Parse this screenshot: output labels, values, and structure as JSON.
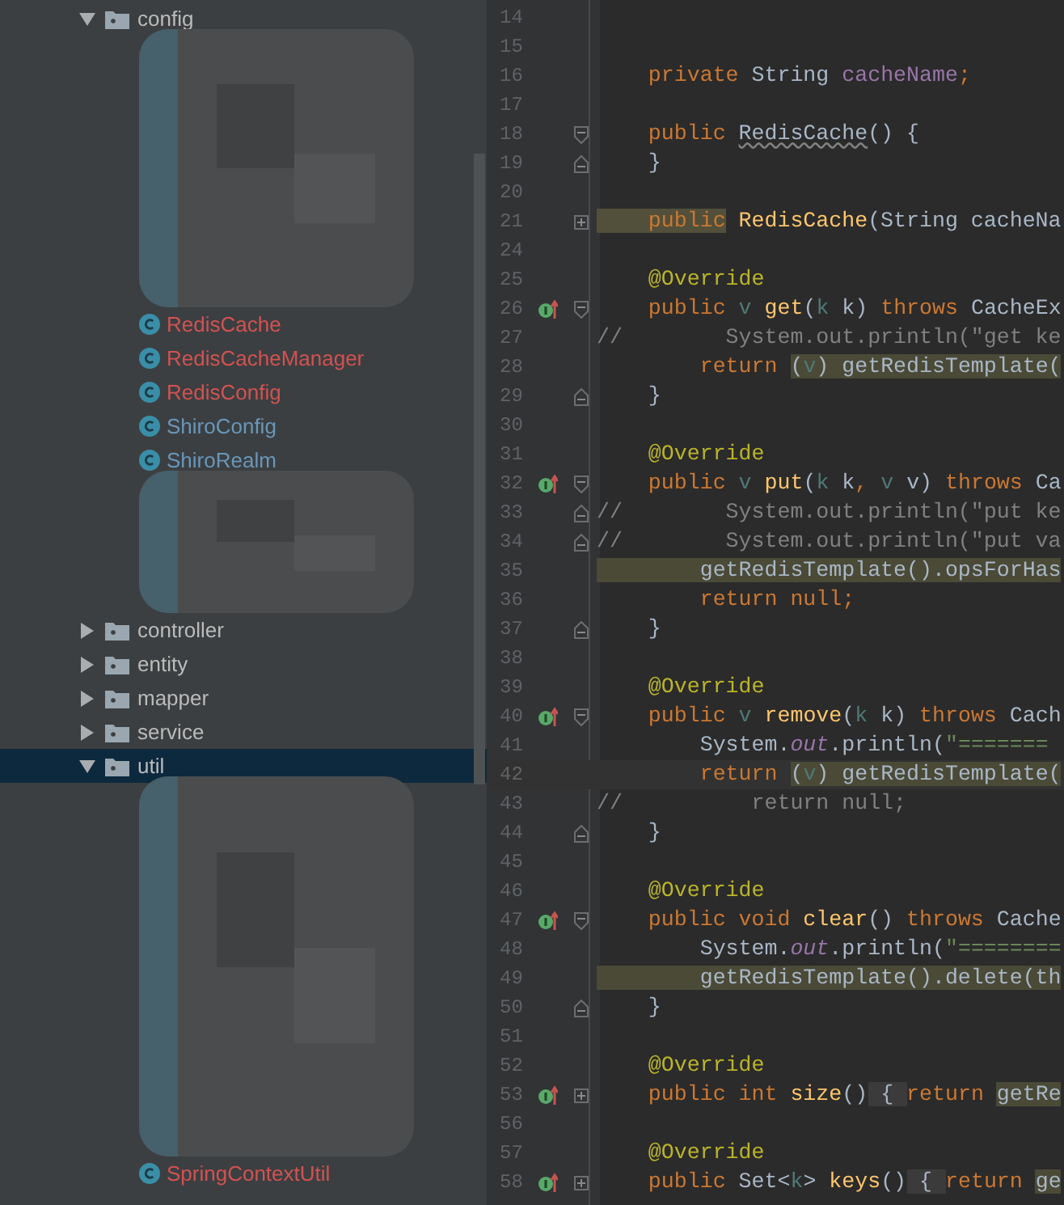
{
  "project_tree": {
    "items": [
      {
        "kind": "folder",
        "label": "config",
        "expanded": true,
        "selected": false,
        "children": [
          {
            "kind": "redacted"
          },
          {
            "kind": "class",
            "label": "RedisCache",
            "color": "#d25252",
            "selected": false
          },
          {
            "kind": "class",
            "label": "RedisCacheManager",
            "color": "#d25252",
            "selected": false
          },
          {
            "kind": "class",
            "label": "RedisConfig",
            "color": "#d25252",
            "selected": false
          },
          {
            "kind": "class",
            "label": "ShiroConfig",
            "color": "#6897bb",
            "selected": false
          },
          {
            "kind": "class",
            "label": "ShiroRealm",
            "color": "#6897bb",
            "selected": false
          },
          {
            "kind": "redacted"
          }
        ]
      },
      {
        "kind": "folder",
        "label": "controller",
        "expanded": false,
        "selected": false
      },
      {
        "kind": "folder",
        "label": "entity",
        "expanded": false,
        "selected": false
      },
      {
        "kind": "folder",
        "label": "mapper",
        "expanded": false,
        "selected": false
      },
      {
        "kind": "folder",
        "label": "service",
        "expanded": false,
        "selected": false
      },
      {
        "kind": "folder",
        "label": "util",
        "expanded": true,
        "selected": true,
        "children": [
          {
            "kind": "redacted"
          },
          {
            "kind": "class",
            "label": "SpringContextUtil",
            "color": "#d25252",
            "selected": false
          }
        ]
      }
    ]
  },
  "editor": {
    "lines": [
      {
        "number": "14",
        "override": false,
        "current": false
      },
      {
        "number": "15",
        "override": false,
        "current": false
      },
      {
        "number": "16",
        "override": false,
        "current": false,
        "tokens": [
          {
            "kind": "keyword",
            "text": "    private"
          },
          {
            "kind": "plain",
            "text": " String "
          },
          {
            "kind": "field",
            "text": "cacheName"
          },
          {
            "kind": "keyword",
            "text": ";"
          }
        ]
      },
      {
        "number": "17",
        "override": false,
        "current": false
      },
      {
        "number": "18",
        "override": false,
        "fold": {
          "kind": "start"
        },
        "current": false,
        "tokens": [
          {
            "kind": "keyword",
            "text": "    public "
          },
          {
            "kind": "unused",
            "text": "RedisCache"
          },
          {
            "kind": "plain",
            "text": "() {"
          }
        ]
      },
      {
        "number": "19",
        "override": false,
        "fold": {
          "kind": "end"
        },
        "current": false,
        "tokens": [
          {
            "kind": "plain",
            "text": "    }"
          }
        ]
      },
      {
        "number": "20",
        "override": false,
        "current": false
      },
      {
        "number": "21",
        "override": false,
        "fold": {
          "kind": "collapsed"
        },
        "current": false,
        "tokens": [
          {
            "kind": "keyword-highlighted",
            "text": "    public"
          },
          {
            "kind": "method",
            "text": " RedisCache"
          },
          {
            "kind": "plain",
            "text": "(String cacheNa"
          }
        ]
      },
      {
        "number": "24",
        "override": false,
        "current": false
      },
      {
        "number": "25",
        "override": false,
        "current": false,
        "tokens": [
          {
            "kind": "annotation",
            "text": "    @Override"
          }
        ]
      },
      {
        "number": "26",
        "override": true,
        "fold": {
          "kind": "start"
        },
        "current": false,
        "tokens": [
          {
            "kind": "keyword",
            "text": "    public"
          },
          {
            "kind": "param",
            "text": " v "
          },
          {
            "kind": "method",
            "text": "get"
          },
          {
            "kind": "plain",
            "text": "("
          },
          {
            "kind": "param",
            "text": "k"
          },
          {
            "kind": "plain",
            "text": " k) "
          },
          {
            "kind": "keyword",
            "text": "throws"
          },
          {
            "kind": "plain",
            "text": " CacheEx"
          }
        ]
      },
      {
        "number": "27",
        "override": false,
        "current": false,
        "tokens": [
          {
            "kind": "comment",
            "text": "//        System.out.println(\"get ke"
          }
        ]
      },
      {
        "number": "28",
        "override": false,
        "current": false,
        "tokens": [
          {
            "kind": "keyword",
            "text": "        return "
          },
          {
            "kind": "plain-highlighted",
            "text": "("
          },
          {
            "kind": "param-highlighted",
            "text": "v"
          },
          {
            "kind": "plain-highlighted",
            "text": ") getRedisTemplate("
          }
        ]
      },
      {
        "number": "29",
        "override": false,
        "fold": {
          "kind": "end"
        },
        "current": false,
        "tokens": [
          {
            "kind": "plain",
            "text": "    }"
          }
        ]
      },
      {
        "number": "30",
        "override": false,
        "current": false
      },
      {
        "number": "31",
        "override": false,
        "current": false,
        "tokens": [
          {
            "kind": "annotation",
            "text": "    @Override"
          }
        ]
      },
      {
        "number": "32",
        "override": true,
        "fold": {
          "kind": "start"
        },
        "current": false,
        "tokens": [
          {
            "kind": "keyword",
            "text": "    public"
          },
          {
            "kind": "param",
            "text": " v "
          },
          {
            "kind": "method",
            "text": "put"
          },
          {
            "kind": "plain",
            "text": "("
          },
          {
            "kind": "param",
            "text": "k"
          },
          {
            "kind": "plain",
            "text": " k"
          },
          {
            "kind": "keyword",
            "text": ", "
          },
          {
            "kind": "param",
            "text": "v"
          },
          {
            "kind": "plain",
            "text": " v) "
          },
          {
            "kind": "keyword",
            "text": "throws"
          },
          {
            "kind": "plain",
            "text": " Ca"
          }
        ]
      },
      {
        "number": "33",
        "override": false,
        "fold": {
          "kind": "end"
        },
        "current": false,
        "tokens": [
          {
            "kind": "comment",
            "text": "//        System.out.println(\"put ke"
          }
        ]
      },
      {
        "number": "34",
        "override": false,
        "fold": {
          "kind": "end"
        },
        "current": false,
        "tokens": [
          {
            "kind": "comment",
            "text": "//        System.out.println(\"put va"
          }
        ]
      },
      {
        "number": "35",
        "override": false,
        "current": false,
        "tokens": [
          {
            "kind": "plain-highlighted",
            "text": "        getRedisTemplate().opsForHas"
          }
        ]
      },
      {
        "number": "36",
        "override": false,
        "current": false,
        "tokens": [
          {
            "kind": "keyword",
            "text": "        return null;"
          }
        ]
      },
      {
        "number": "37",
        "override": false,
        "fold": {
          "kind": "end"
        },
        "current": false,
        "tokens": [
          {
            "kind": "plain",
            "text": "    }"
          }
        ]
      },
      {
        "number": "38",
        "override": false,
        "current": false
      },
      {
        "number": "39",
        "override": false,
        "current": false,
        "tokens": [
          {
            "kind": "annotation",
            "text": "    @Override"
          }
        ]
      },
      {
        "number": "40",
        "override": true,
        "fold": {
          "kind": "start"
        },
        "current": false,
        "tokens": [
          {
            "kind": "keyword",
            "text": "    public"
          },
          {
            "kind": "param",
            "text": " v "
          },
          {
            "kind": "method",
            "text": "remove"
          },
          {
            "kind": "plain",
            "text": "("
          },
          {
            "kind": "param",
            "text": "k"
          },
          {
            "kind": "plain",
            "text": " k) "
          },
          {
            "kind": "keyword",
            "text": "throws"
          },
          {
            "kind": "plain",
            "text": " Cach"
          }
        ]
      },
      {
        "number": "41",
        "override": false,
        "current": false,
        "tokens": [
          {
            "kind": "plain",
            "text": "        System."
          },
          {
            "kind": "static",
            "text": "out"
          },
          {
            "kind": "plain",
            "text": ".println("
          },
          {
            "kind": "string",
            "text": "\"======="
          }
        ]
      },
      {
        "number": "42",
        "override": false,
        "current": true,
        "tokens": [
          {
            "kind": "keyword",
            "text": "        return "
          },
          {
            "kind": "plain-highlighted",
            "text": "("
          },
          {
            "kind": "param-highlighted",
            "text": "v"
          },
          {
            "kind": "plain-highlighted",
            "text": ") getRedisTemplate("
          }
        ]
      },
      {
        "number": "43",
        "override": false,
        "current": false,
        "tokens": [
          {
            "kind": "comment",
            "text": "//          return null;"
          }
        ]
      },
      {
        "number": "44",
        "override": false,
        "fold": {
          "kind": "end"
        },
        "current": false,
        "tokens": [
          {
            "kind": "plain",
            "text": "    }"
          }
        ]
      },
      {
        "number": "45",
        "override": false,
        "current": false
      },
      {
        "number": "46",
        "override": false,
        "current": false,
        "tokens": [
          {
            "kind": "annotation",
            "text": "    @Override"
          }
        ]
      },
      {
        "number": "47",
        "override": true,
        "fold": {
          "kind": "start"
        },
        "current": false,
        "tokens": [
          {
            "kind": "keyword",
            "text": "    public void "
          },
          {
            "kind": "method",
            "text": "clear"
          },
          {
            "kind": "plain",
            "text": "() "
          },
          {
            "kind": "keyword",
            "text": "throws"
          },
          {
            "kind": "plain",
            "text": " Cache"
          }
        ]
      },
      {
        "number": "48",
        "override": false,
        "current": false,
        "tokens": [
          {
            "kind": "plain",
            "text": "        System."
          },
          {
            "kind": "static",
            "text": "out"
          },
          {
            "kind": "plain",
            "text": ".println("
          },
          {
            "kind": "string",
            "text": "\"========"
          }
        ]
      },
      {
        "number": "49",
        "override": false,
        "current": false,
        "tokens": [
          {
            "kind": "plain-highlighted",
            "text": "        getRedisTemplate().delete(th"
          }
        ]
      },
      {
        "number": "50",
        "override": false,
        "fold": {
          "kind": "end"
        },
        "current": false,
        "tokens": [
          {
            "kind": "plain",
            "text": "    }"
          }
        ]
      },
      {
        "number": "51",
        "override": false,
        "current": false
      },
      {
        "number": "52",
        "override": false,
        "current": false,
        "tokens": [
          {
            "kind": "annotation",
            "text": "    @Override"
          }
        ]
      },
      {
        "number": "53",
        "override": true,
        "fold": {
          "kind": "collapsed"
        },
        "current": false,
        "tokens": [
          {
            "kind": "keyword",
            "text": "    public int "
          },
          {
            "kind": "method",
            "text": "size"
          },
          {
            "kind": "plain",
            "text": "()"
          },
          {
            "kind": "folded",
            "text": " { "
          },
          {
            "kind": "keyword",
            "text": "return "
          },
          {
            "kind": "plain-highlighted",
            "text": "getRe"
          }
        ]
      },
      {
        "number": "56",
        "override": false,
        "current": false
      },
      {
        "number": "57",
        "override": false,
        "current": false,
        "tokens": [
          {
            "kind": "annotation",
            "text": "    @Override"
          }
        ]
      },
      {
        "number": "58",
        "override": true,
        "fold": {
          "kind": "collapsed"
        },
        "current": false,
        "tokens": [
          {
            "kind": "keyword",
            "text": "    public"
          },
          {
            "kind": "plain",
            "text": " Set<"
          },
          {
            "kind": "param",
            "text": "k"
          },
          {
            "kind": "plain",
            "text": "> "
          },
          {
            "kind": "method",
            "text": "keys"
          },
          {
            "kind": "plain",
            "text": "()"
          },
          {
            "kind": "folded",
            "text": " { "
          },
          {
            "kind": "keyword",
            "text": "return "
          },
          {
            "kind": "plain-highlighted",
            "text": "ge"
          }
        ]
      }
    ]
  }
}
